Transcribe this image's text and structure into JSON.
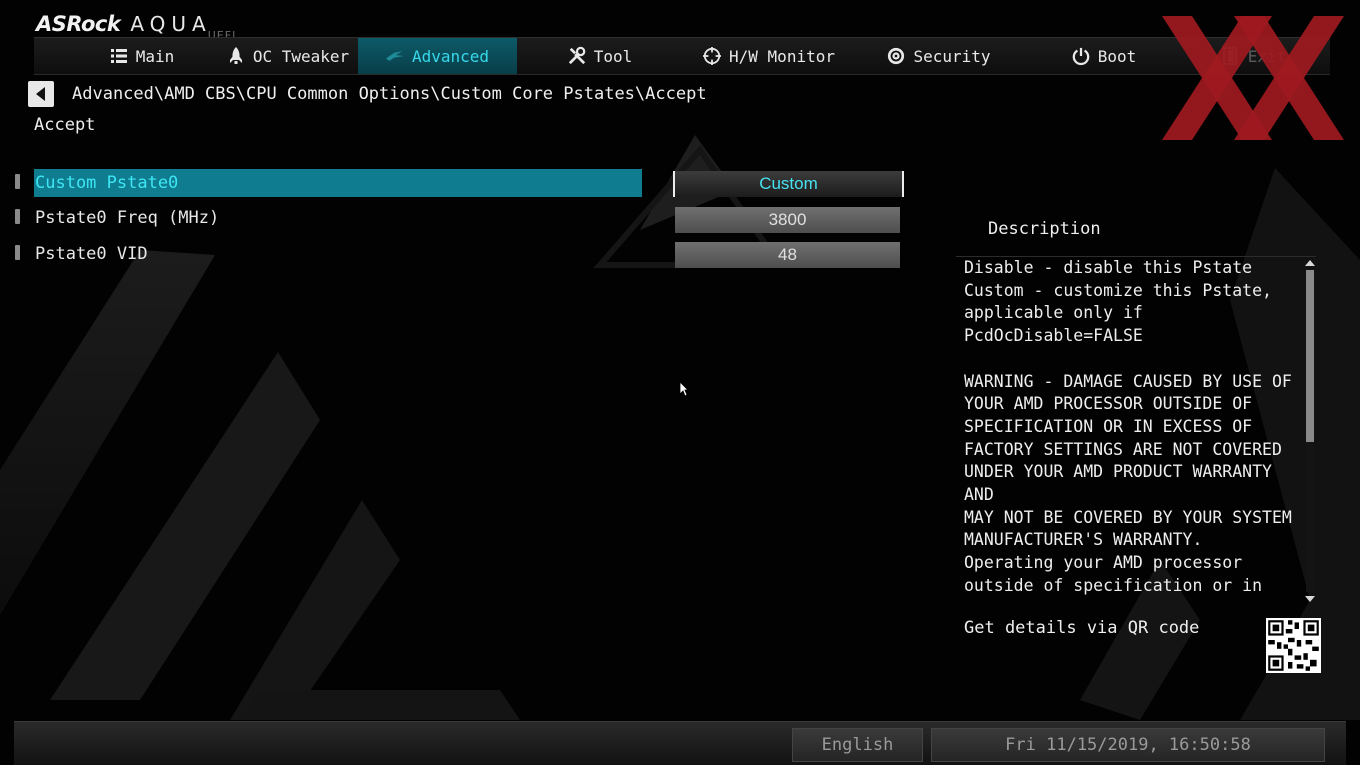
{
  "logo": {
    "brand": "ASRock",
    "aqua": "AQUA",
    "uefi": "UEFI"
  },
  "tabs": [
    {
      "label": "Main",
      "icon": "list-icon",
      "active": false
    },
    {
      "label": "OC Tweaker",
      "icon": "rocket-icon",
      "active": false
    },
    {
      "label": "Advanced",
      "icon": "star-icon",
      "active": true
    },
    {
      "label": "Tool",
      "icon": "tools-icon",
      "active": false
    },
    {
      "label": "H/W Monitor",
      "icon": "monitor-crosshair-icon",
      "active": false
    },
    {
      "label": "Security",
      "icon": "shield-icon",
      "active": false
    },
    {
      "label": "Boot",
      "icon": "power-icon",
      "active": false
    },
    {
      "label": "Exit",
      "icon": "exit-door-icon",
      "active": false
    }
  ],
  "breadcrumb": "Advanced\\AMD CBS\\CPU Common Options\\Custom Core Pstates\\Accept",
  "subtitle": "Accept",
  "settings": [
    {
      "label": "Custom Pstate0",
      "value": "Custom",
      "selected": true
    },
    {
      "label": "Pstate0 Freq (MHz)",
      "value": "3800",
      "selected": false
    },
    {
      "label": "Pstate0 VID",
      "value": "48",
      "selected": false
    }
  ],
  "description": {
    "title": "Description",
    "text": "Disable - disable this Pstate\nCustom - customize this Pstate,\napplicable only if\nPcdOcDisable=FALSE\n\nWARNING - DAMAGE CAUSED BY USE OF\nYOUR AMD PROCESSOR OUTSIDE OF\nSPECIFICATION OR IN EXCESS OF\nFACTORY SETTINGS ARE NOT COVERED\nUNDER YOUR AMD PRODUCT WARRANTY AND\nMAY NOT BE COVERED BY YOUR SYSTEM\nMANUFACTURER'S WARRANTY.\nOperating your AMD processor\noutside of specification or in\nexcess of factory settings,",
    "qr_text": "Get details via QR code"
  },
  "footer": {
    "language": "English",
    "datetime": "Fri 11/15/2019, 16:50:58"
  },
  "colors": {
    "accent": "#38d8ea",
    "selected_row": "#0f7c90",
    "watermark": "#9e1a20"
  }
}
